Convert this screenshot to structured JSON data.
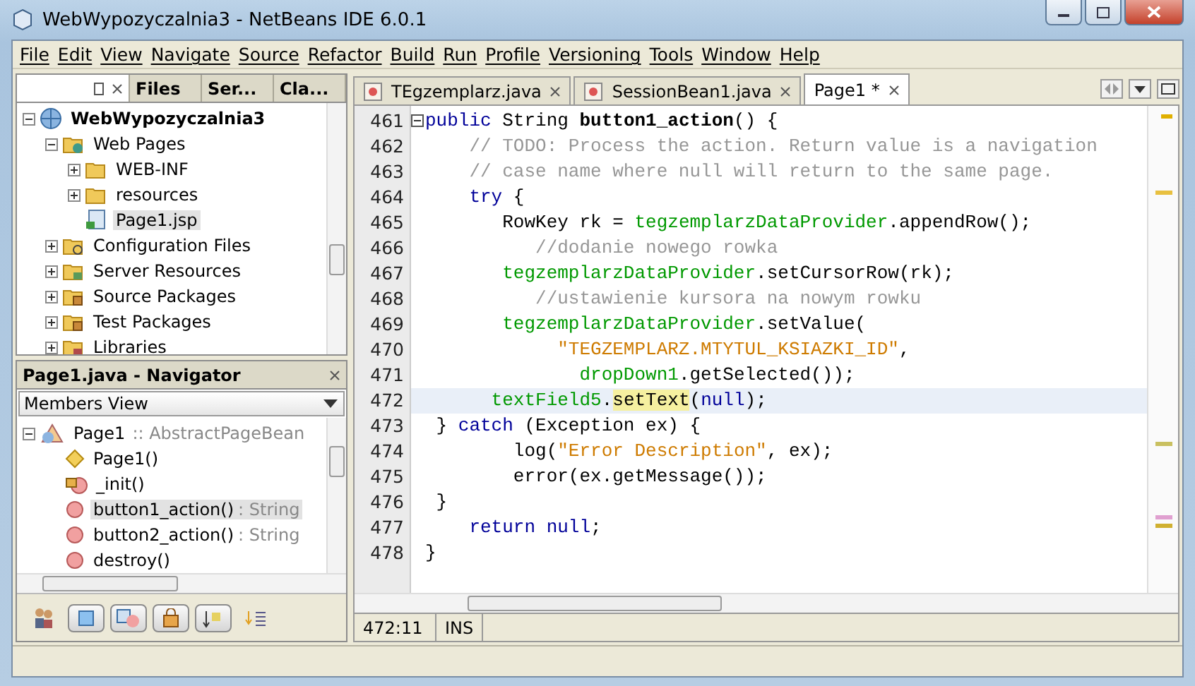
{
  "window": {
    "title": "WebWypozyczalnia3 - NetBeans IDE 6.0.1"
  },
  "menu": [
    "File",
    "Edit",
    "View",
    "Navigate",
    "Source",
    "Refactor",
    "Build",
    "Run",
    "Profile",
    "Versioning",
    "Tools",
    "Window",
    "Help"
  ],
  "left_tabs": [
    {
      "label": "Files",
      "selected": false
    },
    {
      "label": "Ser...",
      "selected": false
    },
    {
      "label": "Cla...",
      "selected": false
    }
  ],
  "project_tree": [
    {
      "label": "WebWypozyczalnia3",
      "kind": "project",
      "expanded": true,
      "selected": false,
      "children": [
        {
          "label": "Web Pages",
          "kind": "webfolder",
          "expanded": true,
          "selected": false,
          "children": [
            {
              "label": "WEB-INF",
              "kind": "folder",
              "expanded": false,
              "selected": false
            },
            {
              "label": "resources",
              "kind": "folder",
              "expanded": false,
              "selected": false
            },
            {
              "label": "Page1.jsp",
              "kind": "page",
              "selected": true
            }
          ]
        },
        {
          "label": "Configuration Files",
          "kind": "configfolder",
          "expanded": false,
          "selected": false
        },
        {
          "label": "Server Resources",
          "kind": "serverfolder",
          "expanded": false,
          "selected": false
        },
        {
          "label": "Source Packages",
          "kind": "package",
          "expanded": false,
          "selected": false
        },
        {
          "label": "Test Packages",
          "kind": "package",
          "expanded": false,
          "selected": false
        },
        {
          "label": "Libraries",
          "kind": "library",
          "expanded": false,
          "selected": false
        }
      ]
    }
  ],
  "navigator": {
    "title": "Page1.java - Navigator",
    "view": "Members View",
    "class_item": {
      "name": "Page1",
      "type": ":: AbstractPageBean",
      "expanded": true
    },
    "members": [
      {
        "name": "Page1()",
        "kind": "constructor",
        "selected": false
      },
      {
        "name": "_init()",
        "kind": "private",
        "selected": false
      },
      {
        "name": "button1_action()",
        "type": ": String",
        "kind": "method",
        "selected": true
      },
      {
        "name": "button2_action()",
        "type": ": String",
        "kind": "method",
        "selected": false
      },
      {
        "name": "destroy()",
        "kind": "method",
        "selected": false
      }
    ]
  },
  "editor_tabs": [
    {
      "label": "TEgzemplarz.java",
      "selected": false
    },
    {
      "label": "SessionBean1.java",
      "selected": false
    },
    {
      "label": "Page1 *",
      "selected": true
    }
  ],
  "code_lines": [
    {
      "number": "461",
      "current": false,
      "tokens": [
        {
          "text": "public",
          "kind": "kw"
        },
        {
          "text": " String ",
          "kind": "plain"
        },
        {
          "text": "button1_action",
          "kind": "bold"
        },
        {
          "text": "() {",
          "kind": "plain"
        }
      ]
    },
    {
      "number": "462",
      "current": false,
      "tokens": [
        {
          "text": "    // TODO: Process the action. Return value is a navigation",
          "kind": "comment"
        }
      ]
    },
    {
      "number": "463",
      "current": false,
      "tokens": [
        {
          "text": "    // case name where null will return to the same page.",
          "kind": "comment"
        }
      ]
    },
    {
      "number": "464",
      "current": false,
      "tokens": [
        {
          "text": "    try",
          "kind": "kw"
        },
        {
          "text": " {",
          "kind": "plain"
        }
      ]
    },
    {
      "number": "465",
      "current": false,
      "tokens": [
        {
          "text": "       RowKey rk = ",
          "kind": "plain"
        },
        {
          "text": "tegzemplarzDataProvider",
          "kind": "field"
        },
        {
          "text": ".appendRow();",
          "kind": "plain"
        }
      ]
    },
    {
      "number": "466",
      "current": false,
      "tokens": [
        {
          "text": "          //dodanie nowego rowka",
          "kind": "comment"
        }
      ]
    },
    {
      "number": "467",
      "current": false,
      "tokens": [
        {
          "text": "       tegzemplarzDataProvider",
          "kind": "field"
        },
        {
          "text": ".setCursorRow(rk);",
          "kind": "plain"
        }
      ]
    },
    {
      "number": "468",
      "current": false,
      "tokens": [
        {
          "text": "          //ustawienie kursora na nowym rowku",
          "kind": "comment"
        }
      ]
    },
    {
      "number": "469",
      "current": false,
      "tokens": [
        {
          "text": "       tegzemplarzDataProvider",
          "kind": "field"
        },
        {
          "text": ".setValue(",
          "kind": "plain"
        }
      ]
    },
    {
      "number": "470",
      "current": false,
      "tokens": [
        {
          "text": "            \"TEGZEMPLARZ.MTYTUL_KSIAZKI_ID\"",
          "kind": "string"
        },
        {
          "text": ",",
          "kind": "plain"
        }
      ]
    },
    {
      "number": "471",
      "current": false,
      "tokens": [
        {
          "text": "              dropDown1",
          "kind": "field"
        },
        {
          "text": ".getSelected());",
          "kind": "plain"
        }
      ]
    },
    {
      "number": "472",
      "current": true,
      "tokens": [
        {
          "text": "      textField5",
          "kind": "field"
        },
        {
          "text": ".",
          "kind": "plain"
        },
        {
          "text": "setText",
          "kind": "mark"
        },
        {
          "text": "(",
          "kind": "plain"
        },
        {
          "text": "null",
          "kind": "kw"
        },
        {
          "text": ");",
          "kind": "plain"
        }
      ]
    },
    {
      "number": "473",
      "current": false,
      "tokens": [
        {
          "text": " } ",
          "kind": "plain"
        },
        {
          "text": "catch",
          "kind": "kw"
        },
        {
          "text": " (Exception ex) {",
          "kind": "plain"
        }
      ]
    },
    {
      "number": "474",
      "current": false,
      "tokens": [
        {
          "text": "        log(",
          "kind": "plain"
        },
        {
          "text": "\"Error Description\"",
          "kind": "string"
        },
        {
          "text": ", ex);",
          "kind": "plain"
        }
      ]
    },
    {
      "number": "475",
      "current": false,
      "tokens": [
        {
          "text": "        error(ex.getMessage());",
          "kind": "plain"
        }
      ]
    },
    {
      "number": "476",
      "current": false,
      "tokens": [
        {
          "text": " }",
          "kind": "plain"
        }
      ]
    },
    {
      "number": "477",
      "current": false,
      "tokens": [
        {
          "text": "    return null",
          "kind": "kw"
        },
        {
          "text": ";",
          "kind": "plain"
        }
      ]
    },
    {
      "number": "478",
      "current": false,
      "tokens": [
        {
          "text": "}",
          "kind": "plain"
        }
      ]
    }
  ],
  "editor_status": {
    "position": "472:11",
    "mode": "INS"
  }
}
